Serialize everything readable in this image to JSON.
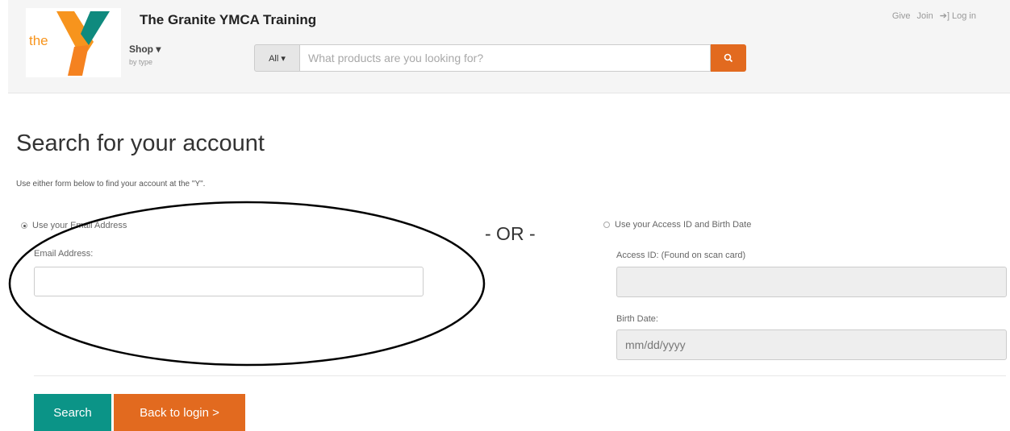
{
  "header": {
    "logo_text": "the",
    "site_title": "The Granite YMCA Training",
    "shop_label": "Shop ▾",
    "shop_sub": "by type",
    "search": {
      "scope_label": "All ▾",
      "placeholder": "What products are you looking for?"
    },
    "links": {
      "give": "Give",
      "join": "Join",
      "login": "Log in"
    }
  },
  "main": {
    "title": "Search for your account",
    "intro": "Use either form below to find your account at the \"Y\".",
    "email_option": {
      "radio_label": "Use your Email Address",
      "selected": true,
      "field_label": "Email Address:",
      "value": ""
    },
    "or_text": "- OR -",
    "access_option": {
      "radio_label": "Use your Access ID and Birth Date",
      "selected": false,
      "access_label": "Access ID: (Found on scan card)",
      "access_value": "",
      "birth_label": "Birth Date:",
      "birth_placeholder": "mm/dd/yyyy"
    },
    "buttons": {
      "search": "Search",
      "back": "Back to login >"
    }
  },
  "colors": {
    "orange": "#e26a1f",
    "teal": "#0b9487",
    "logo_green": "#3aa58e",
    "logo_teal": "#0f8a7e"
  }
}
